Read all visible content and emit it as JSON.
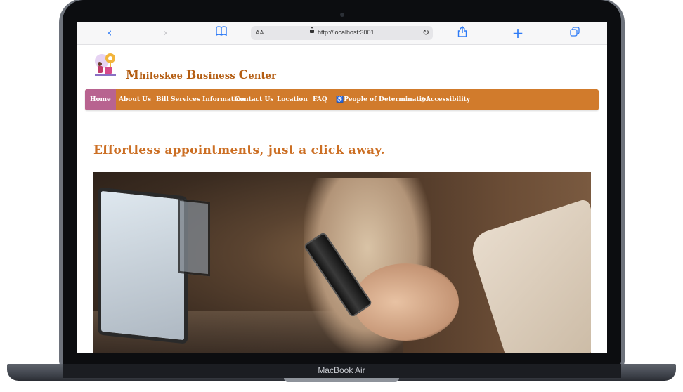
{
  "device": {
    "label": "MacBook Air"
  },
  "browser": {
    "aa_label": "AA",
    "url": "http://localhost:3001"
  },
  "site": {
    "title_parts": [
      "M",
      "hileskee ",
      "B",
      "usiness ",
      "C",
      "enter"
    ],
    "nav": [
      "Home",
      "About Us",
      "Bill Services Information",
      "Contact Us",
      "Location",
      "FAQ",
      "♿People of Determination",
      "◎Accessibility"
    ],
    "tagline": "Effortless appointments, just a click away."
  },
  "icons": {
    "back": "chevron-left-icon",
    "forward": "chevron-right-icon",
    "bookmarks": "book-icon",
    "reload": "reload-icon",
    "share": "share-icon",
    "new_tab": "plus-icon",
    "tabs": "tabs-icon"
  },
  "colors": {
    "nav_bg": "#d17b2c",
    "nav_active": "#b86390",
    "title": "#b45d12",
    "tagline": "#cc6f24"
  }
}
